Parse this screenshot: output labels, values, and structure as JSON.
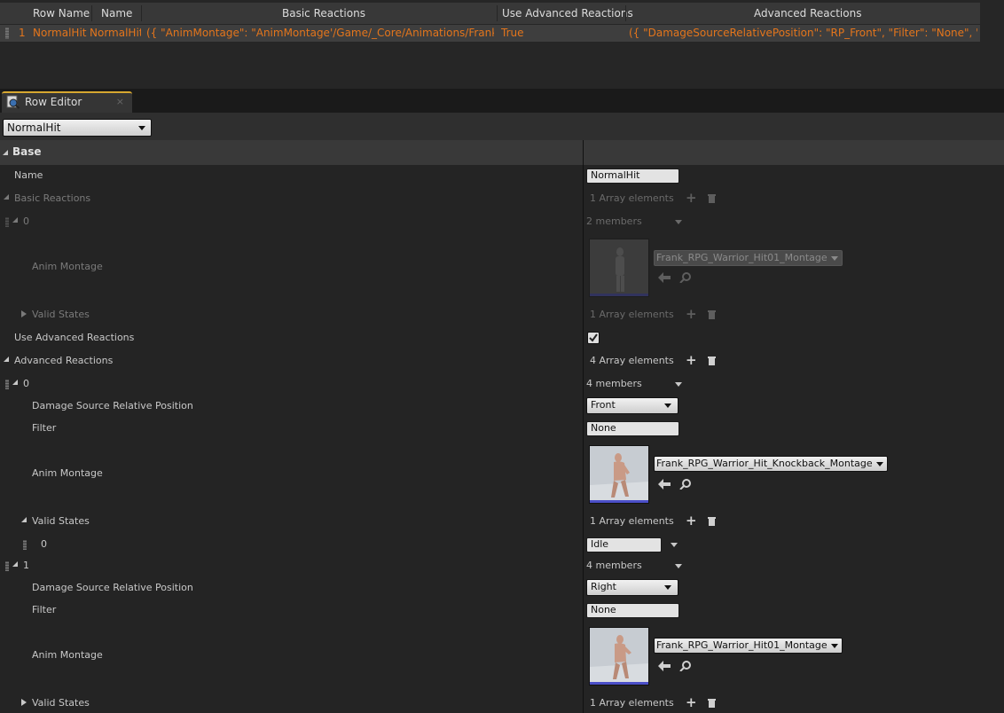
{
  "table": {
    "headers": {
      "row_name": "Row Name",
      "name": "Name",
      "basic_reactions": "Basic Reactions",
      "use_advanced": "Use Advanced Reactions",
      "advanced_reactions": "Advanced Reactions"
    },
    "row": {
      "index": "1",
      "row_name": "NormalHit",
      "name": "NormalHit",
      "basic_reactions": "({ \"AnimMontage\": \"AnimMontage'/Game/_Core/Animations/Frank_Warri",
      "use_advanced": "True",
      "advanced_reactions": "({ \"DamageSourceRelativePosition\": \"RP_Front\", \"Filter\": \"None\", \"AnimMon"
    }
  },
  "tab": {
    "label": "Row Editor",
    "close": "×"
  },
  "row_selector": {
    "value": "NormalHit"
  },
  "details": {
    "category": "Base",
    "name_label": "Name",
    "name_value": "NormalHit",
    "basic_reactions": {
      "label": "Basic Reactions",
      "count": "1 Array elements",
      "element_index": "0",
      "members": "2 members",
      "anim_montage_label": "Anim Montage",
      "anim_montage_value": "Frank_RPG_Warrior_Hit01_Montage",
      "valid_states_label": "Valid States",
      "valid_states_count": "1 Array elements"
    },
    "use_advanced_label": "Use Advanced Reactions",
    "use_advanced_checked": true,
    "advanced_reactions": {
      "label": "Advanced Reactions",
      "count": "4 Array elements",
      "elements": [
        {
          "index": "0",
          "members": "4 members",
          "position_label": "Damage Source Relative Position",
          "position_value": "Front",
          "filter_label": "Filter",
          "filter_value": "None",
          "anim_montage_label": "Anim Montage",
          "anim_montage_value": "Frank_RPG_Warrior_Hit_Knockback_Montage",
          "valid_states_label": "Valid States",
          "valid_states_count": "1 Array elements",
          "valid_state_index": "0",
          "valid_state_value": "Idle"
        },
        {
          "index": "1",
          "members": "4 members",
          "position_label": "Damage Source Relative Position",
          "position_value": "Right",
          "filter_label": "Filter",
          "filter_value": "None",
          "anim_montage_label": "Anim Montage",
          "anim_montage_value": "Frank_RPG_Warrior_Hit01_Montage",
          "valid_states_label": "Valid States",
          "valid_states_count": "1 Array elements"
        }
      ]
    }
  },
  "colors": {
    "accent_orange": "#e3751c",
    "tab_highlight": "#d6a730",
    "thumb_bar": "#4b4fc8"
  }
}
